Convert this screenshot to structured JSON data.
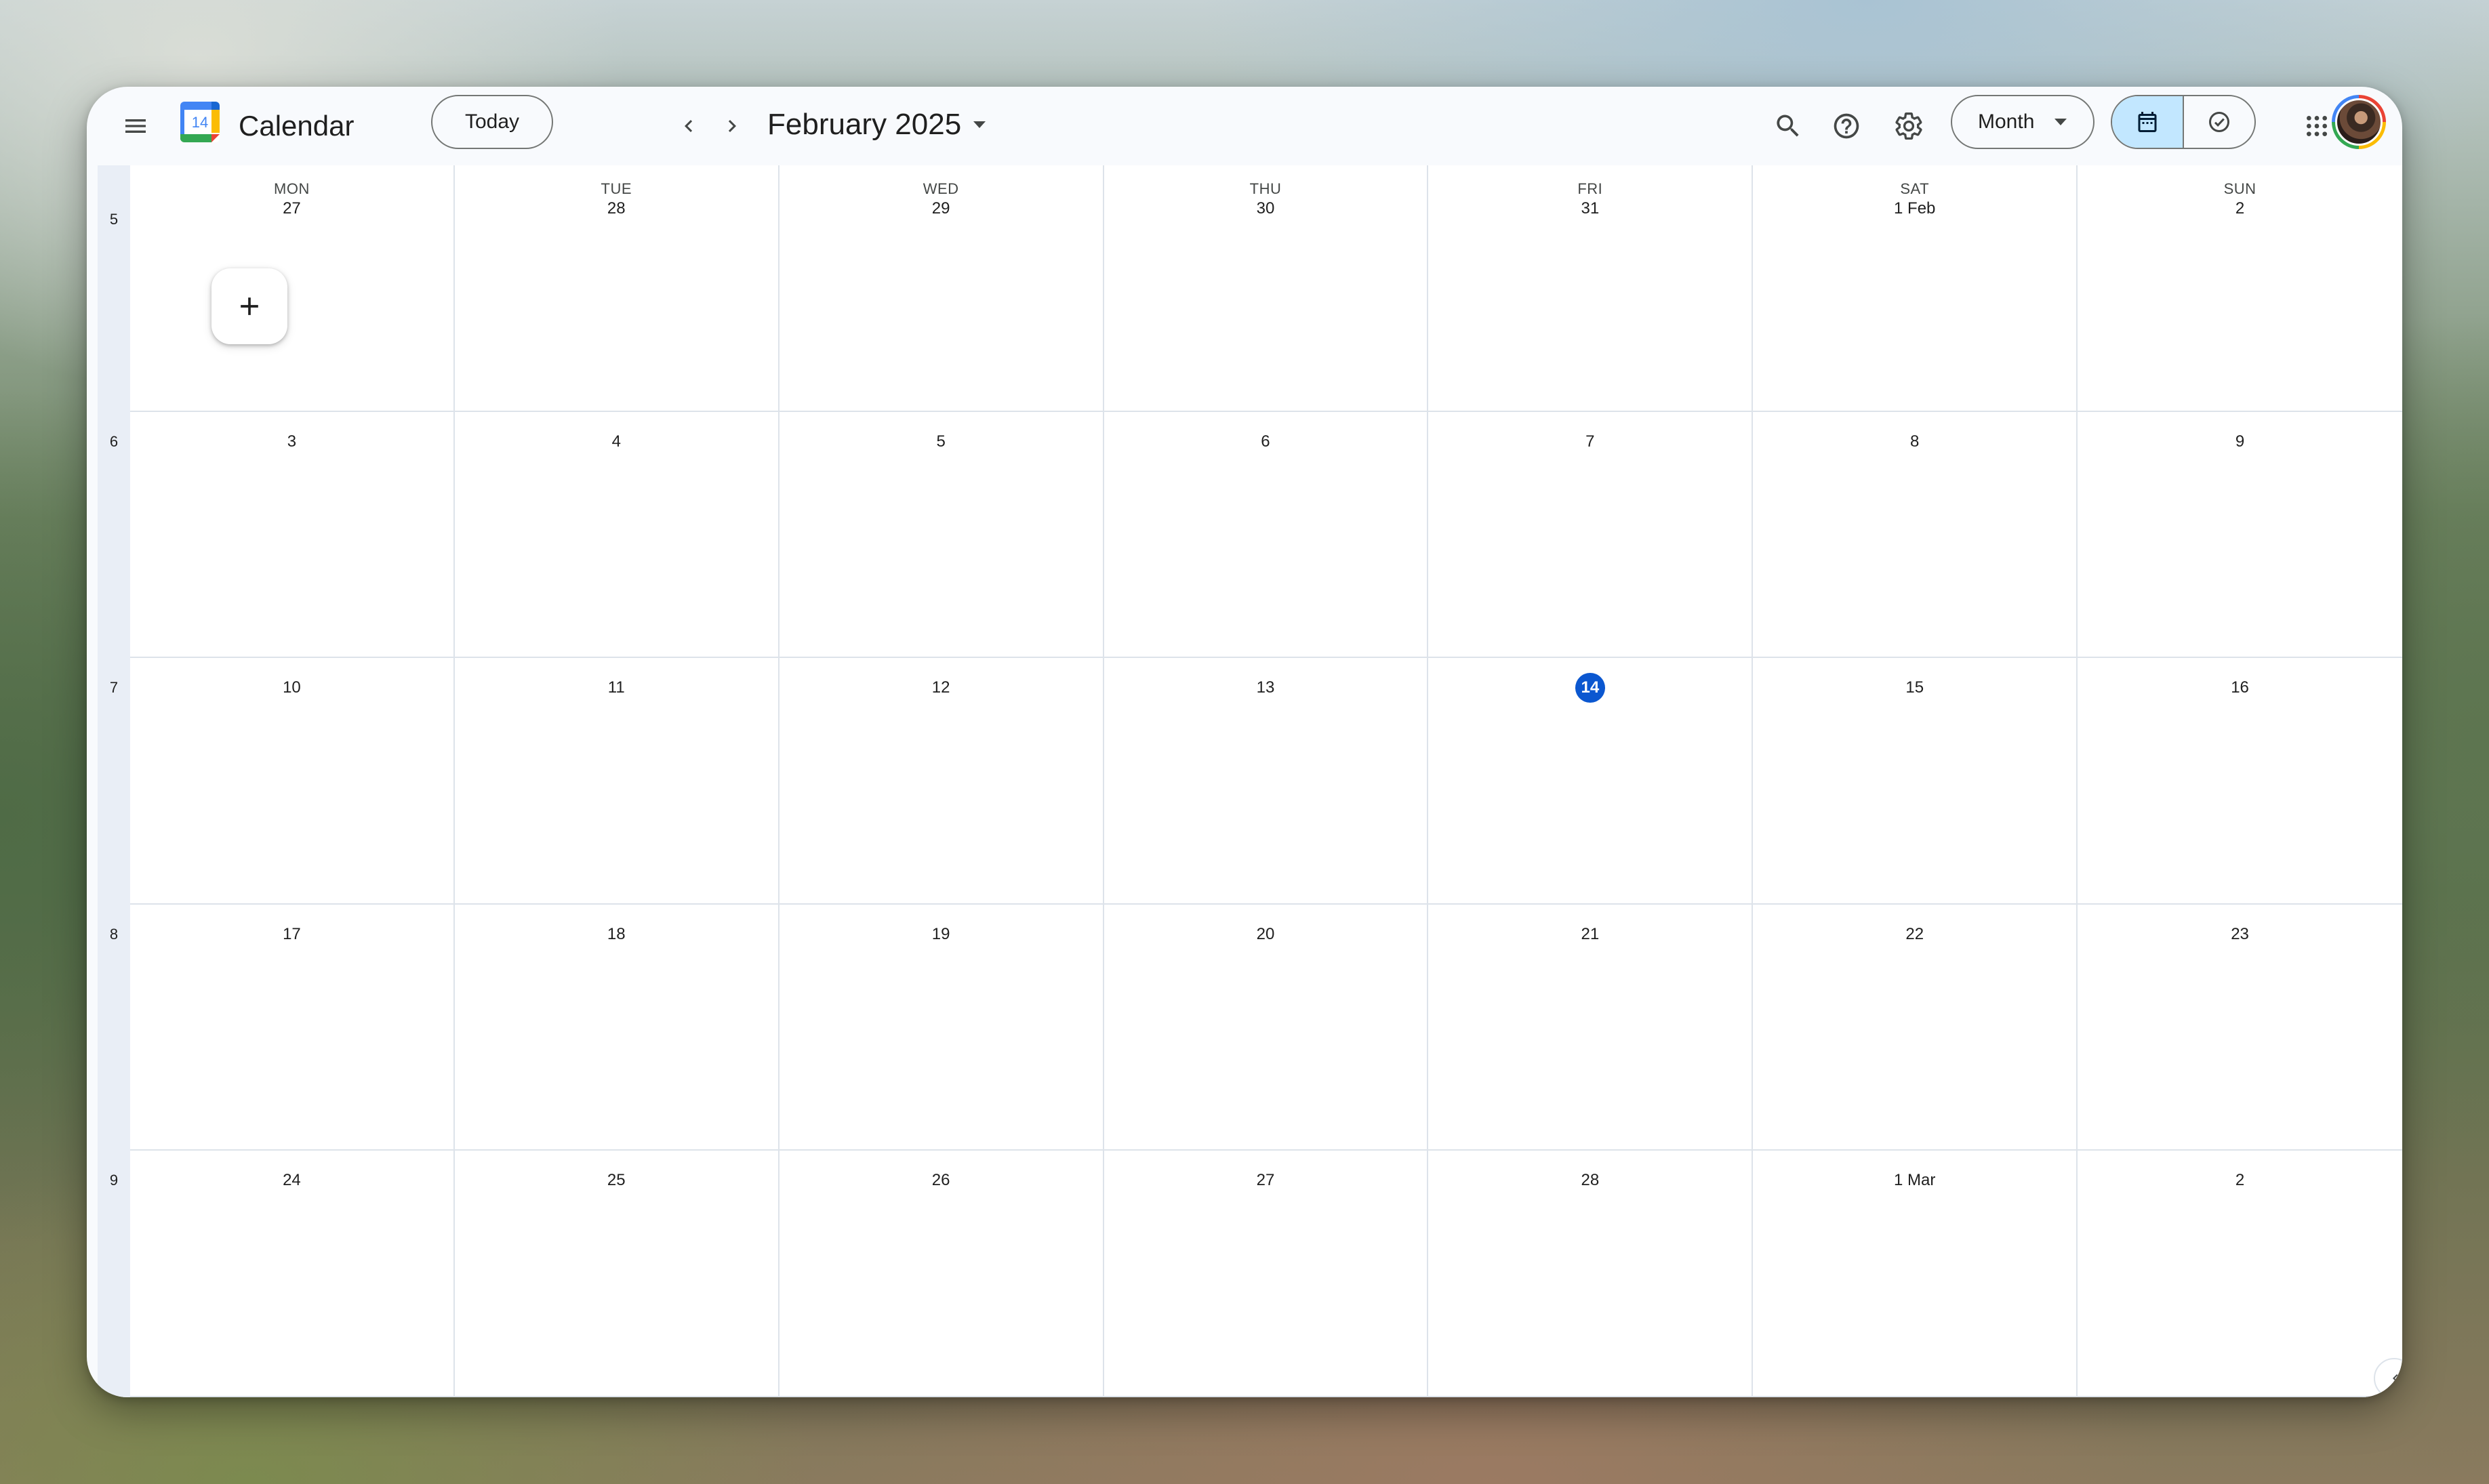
{
  "app": {
    "title": "Calendar",
    "logo_day": "14"
  },
  "header": {
    "today_label": "Today",
    "month_title": "February 2025",
    "view_label": "Month",
    "icons": [
      "menu-icon",
      "chevron-left-icon",
      "chevron-right-icon",
      "search-icon",
      "help-icon",
      "settings-icon",
      "calendar-icon",
      "tasks-check-icon",
      "apps-grid-icon"
    ]
  },
  "calendar": {
    "weekdays": [
      "MON",
      "TUE",
      "WED",
      "THU",
      "FRI",
      "SAT",
      "SUN"
    ],
    "weeks": [
      {
        "number": "5",
        "days": [
          "27",
          "28",
          "29",
          "30",
          "31",
          "1 Feb",
          "2"
        ]
      },
      {
        "number": "6",
        "days": [
          "3",
          "4",
          "5",
          "6",
          "7",
          "8",
          "9"
        ]
      },
      {
        "number": "7",
        "days": [
          "10",
          "11",
          "12",
          "13",
          "14",
          "15",
          "16"
        ]
      },
      {
        "number": "8",
        "days": [
          "17",
          "18",
          "19",
          "20",
          "21",
          "22",
          "23"
        ]
      },
      {
        "number": "9",
        "days": [
          "24",
          "25",
          "26",
          "27",
          "28",
          "1 Mar",
          "2"
        ]
      }
    ],
    "today": {
      "week": 2,
      "day": 4
    }
  },
  "colors": {
    "today_accent": "#0b57d0",
    "active_view_bg": "#c2e7ff",
    "week_column_bg": "#e9eef6"
  }
}
